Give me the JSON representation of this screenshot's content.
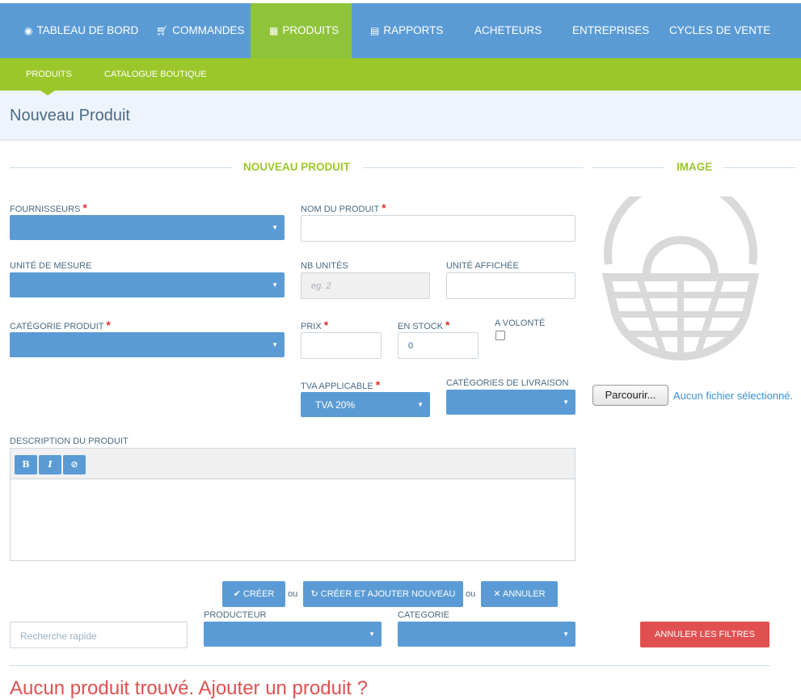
{
  "topnav": {
    "items": [
      {
        "label": "TABLEAU DE BORD",
        "icon": "dashboard-icon"
      },
      {
        "label": "COMMANDES",
        "icon": "cart-icon"
      },
      {
        "label": "PRODUITS",
        "icon": "grid-icon",
        "active": true
      },
      {
        "label": "RAPPORTS",
        "icon": "document-icon"
      },
      {
        "label": "ACHETEURS"
      },
      {
        "label": "ENTREPRISES"
      },
      {
        "label": "CYCLES DE VENTE"
      }
    ]
  },
  "subnav": {
    "items": [
      "PRODUITS",
      "CATALOGUE BOUTIQUE"
    ]
  },
  "page": {
    "title": "Nouveau Produit"
  },
  "sections": {
    "form": "NOUVEAU PRODUIT",
    "image": "IMAGE"
  },
  "form": {
    "fournisseurs_label": "FOURNISSEURS",
    "nom_label": "NOM DU PRODUIT",
    "unite_mesure_label": "UNITÉ DE MESURE",
    "nb_unites_label": "NB UNITÉS",
    "nb_unites_placeholder": "eg. 2",
    "unite_affichee_label": "UNITÉ AFFICHÉE",
    "categorie_label": "CATÉGORIE PRODUIT",
    "prix_label": "PRIX",
    "stock_label": "EN STOCK",
    "stock_value": "0",
    "volonte_label": "A VOLONTÉ",
    "tva_label": "TVA APPLICABLE",
    "tva_value": "TVA 20%",
    "livraison_label": "CATÉGORIES DE LIVRAISON",
    "description_label": "DESCRIPTION DU PRODUIT",
    "required_mark": "*",
    "editor_buttons": [
      "B",
      "I",
      "⊘"
    ]
  },
  "image": {
    "browse_label": "Parcourir...",
    "no_file": "Aucun fichier sélectionné."
  },
  "actions": {
    "create": "CRÉER",
    "create_new": "CRÉER ET AJOUTER NOUVEAU",
    "cancel": "ANNULER",
    "or": "ou"
  },
  "filters": {
    "search_placeholder": "Recherche rapide",
    "producer_label": "PRODUCTEUR",
    "category_label": "CATEGORIE",
    "reset_label": "ANNULER LES FILTRES"
  },
  "results": {
    "empty_text": "Aucun produit trouvé. Ajouter un produit ?"
  },
  "colors": {
    "primary": "#5b9bd5",
    "accent": "#9cc72a",
    "danger": "#e05050"
  }
}
